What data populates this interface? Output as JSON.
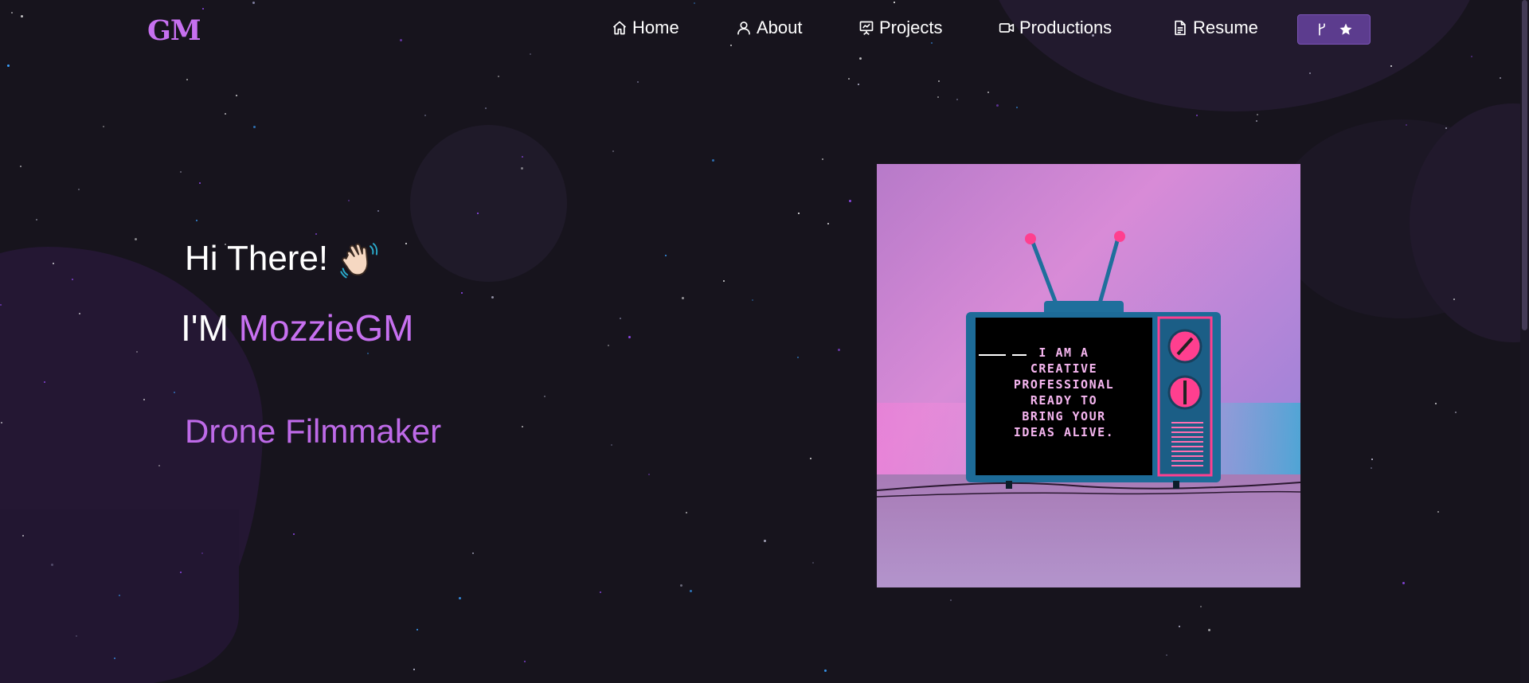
{
  "brand": {
    "logo": "GM",
    "accent_color": "#c770f0"
  },
  "nav": {
    "items": [
      {
        "label": "Home",
        "icon": "home-icon"
      },
      {
        "label": "About",
        "icon": "user-icon"
      },
      {
        "label": "Projects",
        "icon": "presentation-icon"
      },
      {
        "label": "Productions",
        "icon": "video-icon"
      },
      {
        "label": "Resume",
        "icon": "document-icon"
      }
    ],
    "github_button": {
      "icons": [
        "fork-icon",
        "star-icon"
      ]
    }
  },
  "hero": {
    "greeting": "Hi There!",
    "greeting_icon": "waving-hand-icon",
    "name_prefix": "I'M",
    "name": "MozzieGM",
    "role": "Drone Filmmaker"
  },
  "tv_art": {
    "screen_lines": [
      "I AM A",
      "CREATIVE",
      "PROFESSIONAL",
      "READY TO",
      "BRING YOUR",
      "IDEAS ALIVE."
    ]
  }
}
